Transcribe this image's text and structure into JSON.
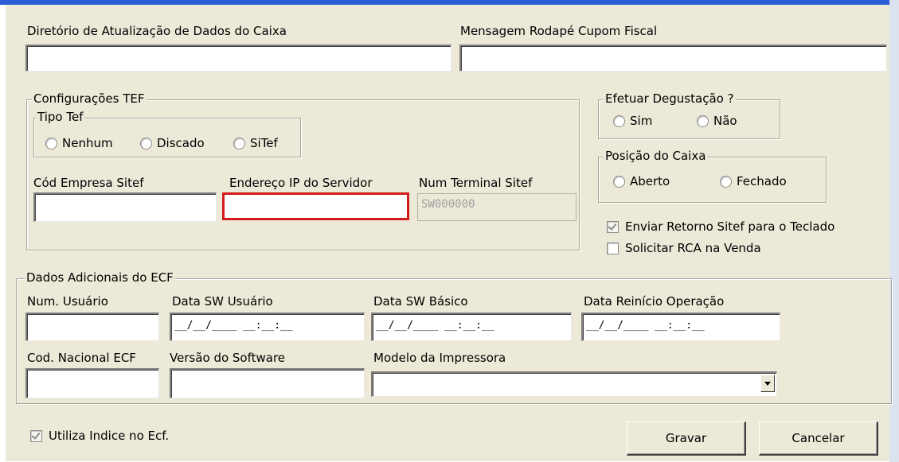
{
  "labels": {
    "diretorio": "Diretório de Atualização de Dados do Caixa",
    "mensagem": "Mensagem Rodapé Cupom Fiscal",
    "cod_empresa": "Cód Empresa Sitef",
    "endereco_ip": "Endereço IP do Servidor",
    "num_terminal": "Num Terminal Sitef",
    "num_usuario": "Num. Usuário",
    "data_sw_usuario": "Data  SW Usuário",
    "data_sw_basico": "Data SW Básico",
    "data_reinicio": "Data Reinício Operação",
    "cod_nacional": "Cod. Nacional ECF",
    "versao_software": "Versão do Software",
    "modelo_impressora": "Modelo da Impressora"
  },
  "groups": {
    "config_tef": "Configurações TEF",
    "tipo_tef": "Tipo Tef",
    "degustacao": "Efetuar Degustação ?",
    "posicao_caixa": "Posição do Caixa",
    "dados_ecf": "Dados Adicionais do ECF"
  },
  "radios": {
    "tipo_tef": [
      "Nenhum",
      "Discado",
      "SiTef"
    ],
    "degustacao": [
      "Sim",
      "Não"
    ],
    "posicao_caixa": [
      "Aberto",
      "Fechado"
    ]
  },
  "fields": {
    "num_terminal_value": "SW000000",
    "date_mask": "__/__/____ __:__:__"
  },
  "checkboxes": {
    "enviar_retorno": {
      "label": "Enviar Retorno Sitef para o Teclado",
      "checked": true
    },
    "solicitar_rca": {
      "label": "Solicitar RCA na Venda",
      "checked": false
    },
    "utiliza_indice": {
      "label": "Utiliza Indice no Ecf.",
      "checked": true
    }
  },
  "buttons": {
    "gravar": "Gravar",
    "cancelar": "Cancelar"
  },
  "colors": {
    "window_bg": "#ece9d8",
    "focus_highlight": "#d21c1c",
    "title_bar": "#2b5bd7"
  }
}
